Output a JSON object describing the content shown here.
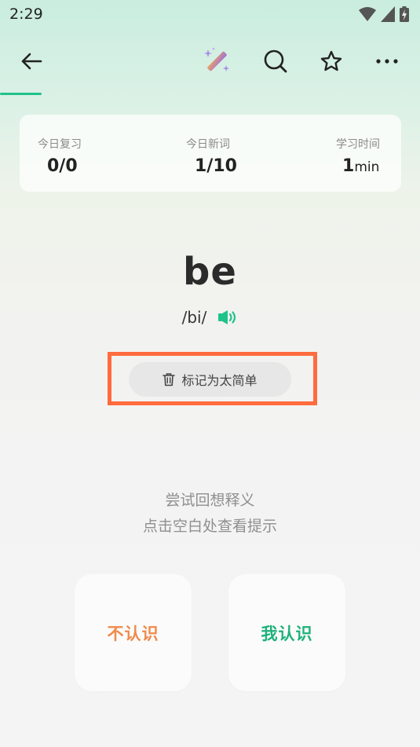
{
  "status_bar": {
    "time": "2:29"
  },
  "toolbar": {
    "back_icon": "arrow-left-icon",
    "magic_icon": "magic-wand-icon",
    "search_icon": "search-icon",
    "favorite_icon": "star-outline-icon",
    "more_icon": "more-horizontal-icon",
    "accent_color": "#1fc38a"
  },
  "stats": {
    "review": {
      "label": "今日复习",
      "value": "0/0"
    },
    "new_words": {
      "label": "今日新词",
      "value": "1/10"
    },
    "study_time": {
      "label": "学习时间",
      "value": "1",
      "unit": "min"
    }
  },
  "word": {
    "text": "be",
    "phonetic": "/bi/",
    "speaker_icon": "speaker-icon",
    "speaker_color": "#1fc38a"
  },
  "mark_easy": {
    "label": "标记为太简单",
    "icon": "trash-icon",
    "highlight_color": "#ff6b3d"
  },
  "hint": {
    "line1": "尝试回想释义",
    "line2": "点击空白处查看提示"
  },
  "answers": {
    "unknown": {
      "label": "不认识",
      "color": "#f08a4b"
    },
    "known": {
      "label": "我认识",
      "color": "#1fb17b"
    }
  }
}
